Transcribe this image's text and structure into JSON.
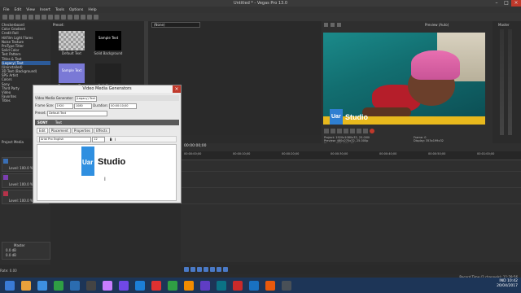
{
  "window": {
    "title": "Untitled * - Vegas Pro 13.0"
  },
  "menu": [
    "File",
    "Edit",
    "View",
    "Insert",
    "Tools",
    "Options",
    "Help"
  ],
  "explorer": {
    "items": [
      "Checkerboard",
      "Color Gradient",
      "Credit Roll",
      "HitFilm Light Flares",
      "Noise Texture",
      "ProType Titler",
      "Solid Color",
      "Test Pattern",
      "Titles & Text",
      "(Legacy) Text",
      "(Uninstalled)",
      "3D Text (Background)",
      "SPG Artist",
      "Colors",
      "Sony",
      "Third Party",
      "Video",
      "Favorites",
      "Titles"
    ],
    "selected_index": 9,
    "tab_label": "Project Media"
  },
  "presets": {
    "header": "Preset:",
    "items": [
      {
        "caption": "Default Text",
        "label": ""
      },
      {
        "caption": "Solid Background",
        "label": "Sample Text"
      },
      {
        "caption": "Transparent Text",
        "label": "Sample Text"
      },
      {
        "caption": "Soft Shadow",
        "label": ""
      }
    ]
  },
  "fx": {
    "preset_value": "(None)"
  },
  "preview": {
    "mode": "Preview (Auto)",
    "overlay_text": "Uar",
    "overlay_title": "Studio",
    "info_lines": [
      "Project: 1920x1080x32, 25.000i",
      "Preview: 480x270x32, 25.000p",
      "Display: 353x199x32"
    ],
    "info_right": [
      "Frame: 0",
      "Display: 353x199x32"
    ]
  },
  "master": {
    "label": "Master"
  },
  "tracks": [
    {
      "level": "Level: 100.0 %",
      "color": "#3a6fb5"
    },
    {
      "level": "Level: 100.0 %",
      "color": "#7b3fb0"
    },
    {
      "level": "Level: 100.0 %",
      "color": "#b5334a"
    }
  ],
  "master_bus": {
    "label": "Master",
    "values": [
      "0.0 dB",
      "0.0 dB"
    ]
  },
  "status": {
    "left": "Rate: 0.00",
    "right": "Record Time (2 channels): 11:29:56"
  },
  "ruler": [
    "00:00:00;00",
    "00:00:10;00",
    "00:00:20;00",
    "00:00:30;00",
    "00:00:40;00",
    "00:00:50;00",
    "00:01:00;00"
  ],
  "timecode": "00:00:00;00",
  "dialog": {
    "title": "Video Media Generators",
    "generator_label": "Video Media Generator:",
    "generator_value": "(Legacy) Text",
    "frame_size_label": "Frame Size:",
    "frame_w": "1920",
    "frame_h": "1080",
    "duration_label": "Duration:",
    "duration_value": "00:00:10;00",
    "preset_label": "Preset:",
    "preset_value": "Default Text",
    "sony_label": "SONY",
    "sony_sub": "Text",
    "tabs": [
      "Edit",
      "Placement",
      "Properties",
      "Effects"
    ],
    "font_value": "Arial Pro English",
    "font_size": "12",
    "text_uar": "Uar",
    "text_studio": "Studio"
  },
  "tray": {
    "lang": "IND",
    "time": "10:42",
    "date": "20/04/2017"
  },
  "colors": {
    "accent": "#2f8fe0",
    "overlay_bar": "#e8b91d",
    "close": "#c0392b"
  }
}
